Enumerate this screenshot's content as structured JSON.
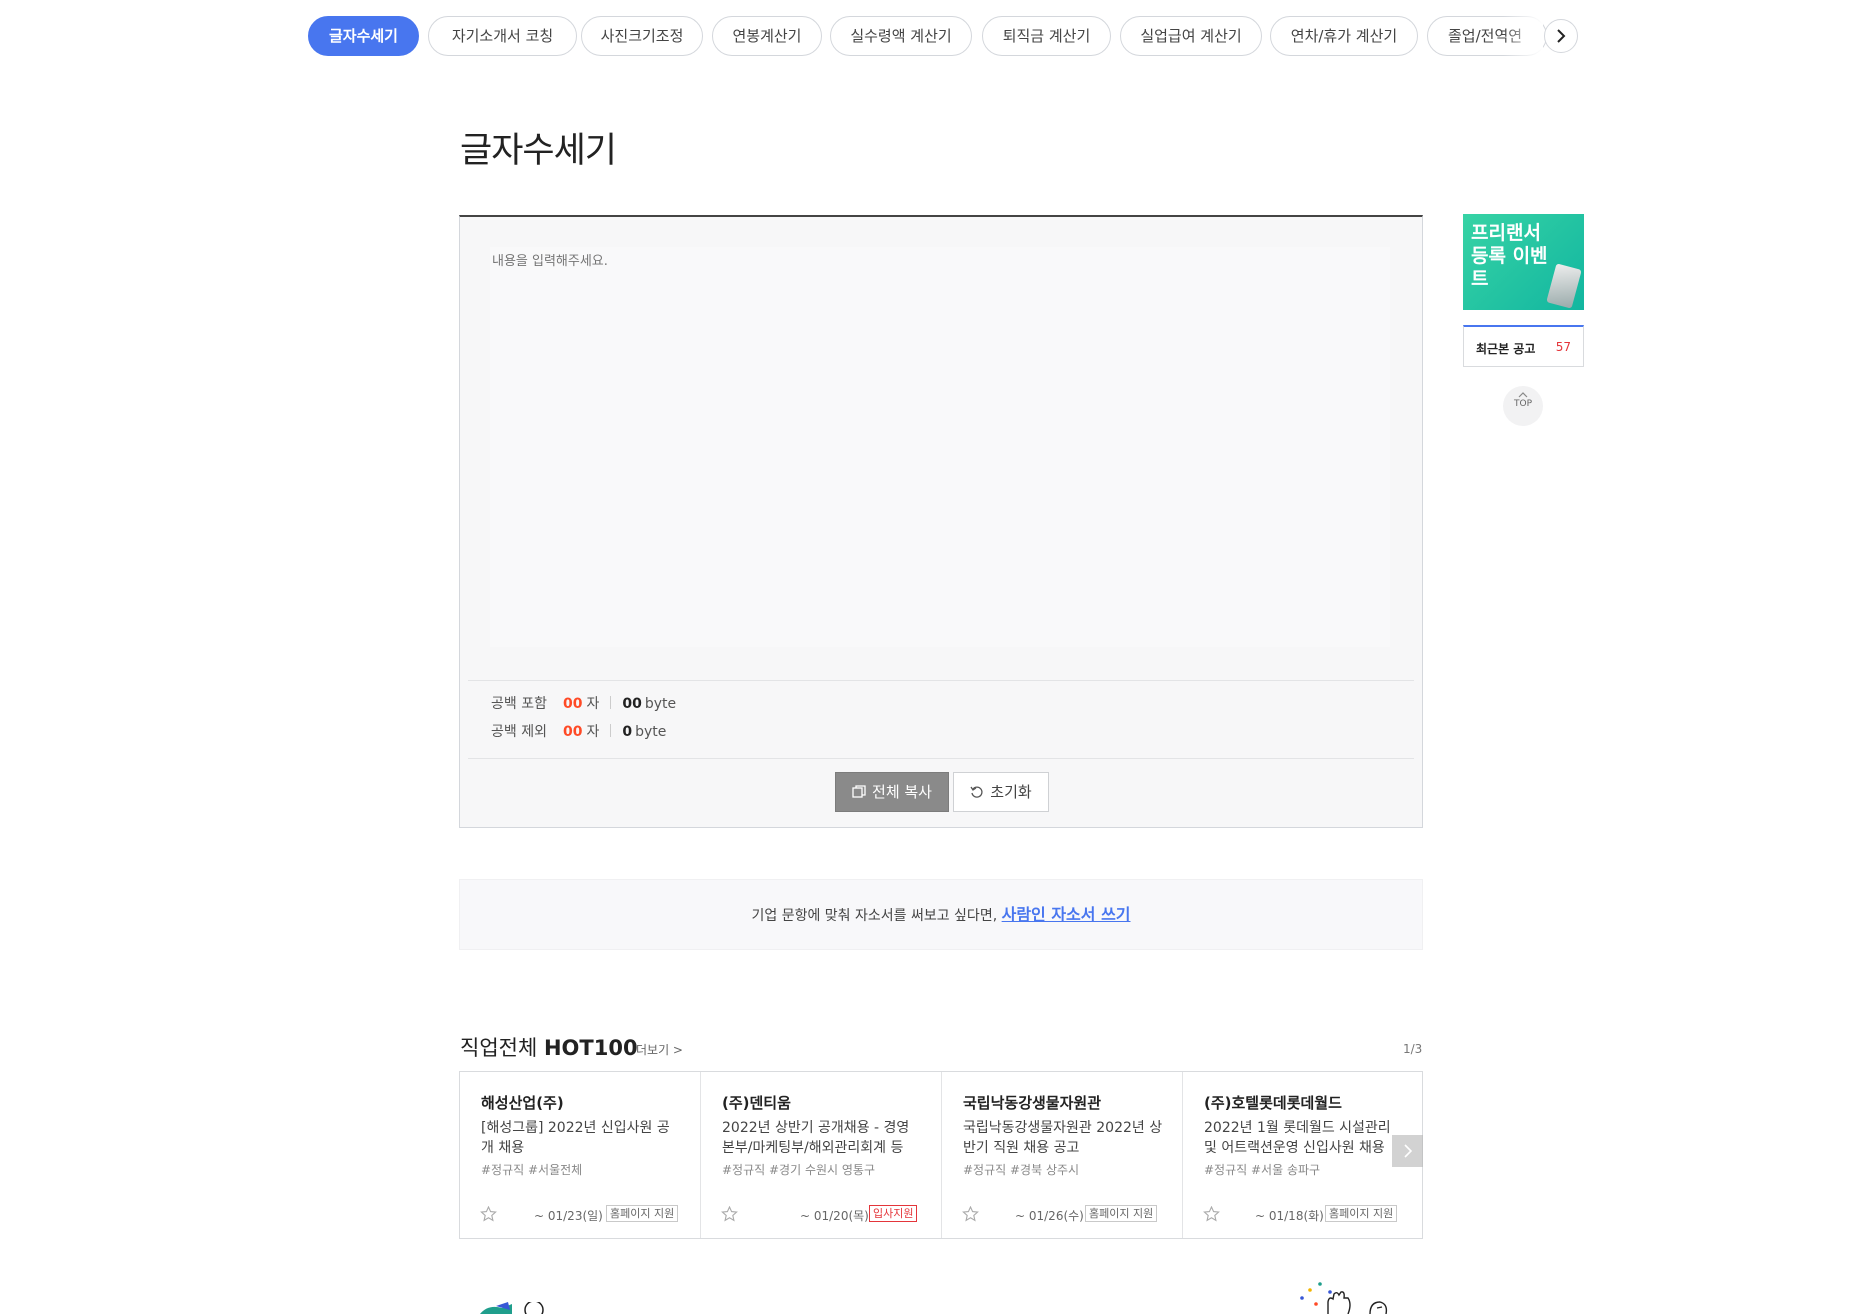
{
  "tabs": [
    {
      "label": "글자수세기",
      "active": true
    },
    {
      "label": "자기소개서 코칭"
    },
    {
      "label": "사진크기조정"
    },
    {
      "label": "연봉계산기"
    },
    {
      "label": "실수령액 계산기"
    },
    {
      "label": "퇴직금 계산기"
    },
    {
      "label": "실업급여 계산기"
    },
    {
      "label": "연차/휴가 계산기"
    },
    {
      "label": "졸업/전역연"
    }
  ],
  "page_title": "글자수세기",
  "counter": {
    "placeholder": "내용을 입력해주세요.",
    "with_space": {
      "label": "공백 포함",
      "chars": "00",
      "char_unit": "자",
      "bytes": "00",
      "byte_unit": "byte"
    },
    "without_space": {
      "label": "공백 제외",
      "chars": "00",
      "char_unit": "자",
      "bytes": "0",
      "byte_unit": "byte"
    },
    "copy_label": "전체 복사",
    "reset_label": "초기화"
  },
  "promo": {
    "text": "기업 문항에 맞춰 자소서를 써보고 싶다면,",
    "link": "사람인 자소서 쓰기"
  },
  "hot": {
    "title_prefix": "직업전체",
    "title_bold": "HOT100",
    "more": "더보기 >",
    "page": "1/3",
    "jobs": [
      {
        "company": "해성산업(주)",
        "title": "[해성그룹] 2022년 신입사원 공개 채용",
        "tags": "#정규직 #서울전체",
        "deadline": "~ 01/23(일)",
        "badge": "홈페이지 지원"
      },
      {
        "company": "(주)덴티움",
        "title": "2022년 상반기 공개채용 - 경영본부/마케팅부/해외관리회계 등",
        "tags": "#정규직 #경기 수원시 영통구",
        "deadline": "~ 01/20(목)",
        "badge": "입사지원"
      },
      {
        "company": "국립낙동강생물자원관",
        "title": "국립낙동강생물자원관 2022년 상반기 직원 채용 공고",
        "tags": "#정규직 #경북 상주시",
        "deadline": "~ 01/26(수)",
        "badge": "홈페이지 지원"
      },
      {
        "company": "(주)호텔롯데롯데월드",
        "title": "2022년 1월 롯데월드 시설관리 및 어트랙션운영 신입사원 채용",
        "tags": "#정규직 #서울 송파구",
        "deadline": "~ 01/18(화)",
        "badge": "홈페이지 지원"
      }
    ]
  },
  "sidebar": {
    "ad_text": "프리랜서 등록 이벤트",
    "recent_label": "최근본 공고",
    "recent_count": "57",
    "top_label": "TOP"
  },
  "colors": {
    "accent": "#4876ef",
    "count_red": "#ff4a26",
    "badge_red": "#e4353a",
    "ad_green": "#26c6a4"
  }
}
